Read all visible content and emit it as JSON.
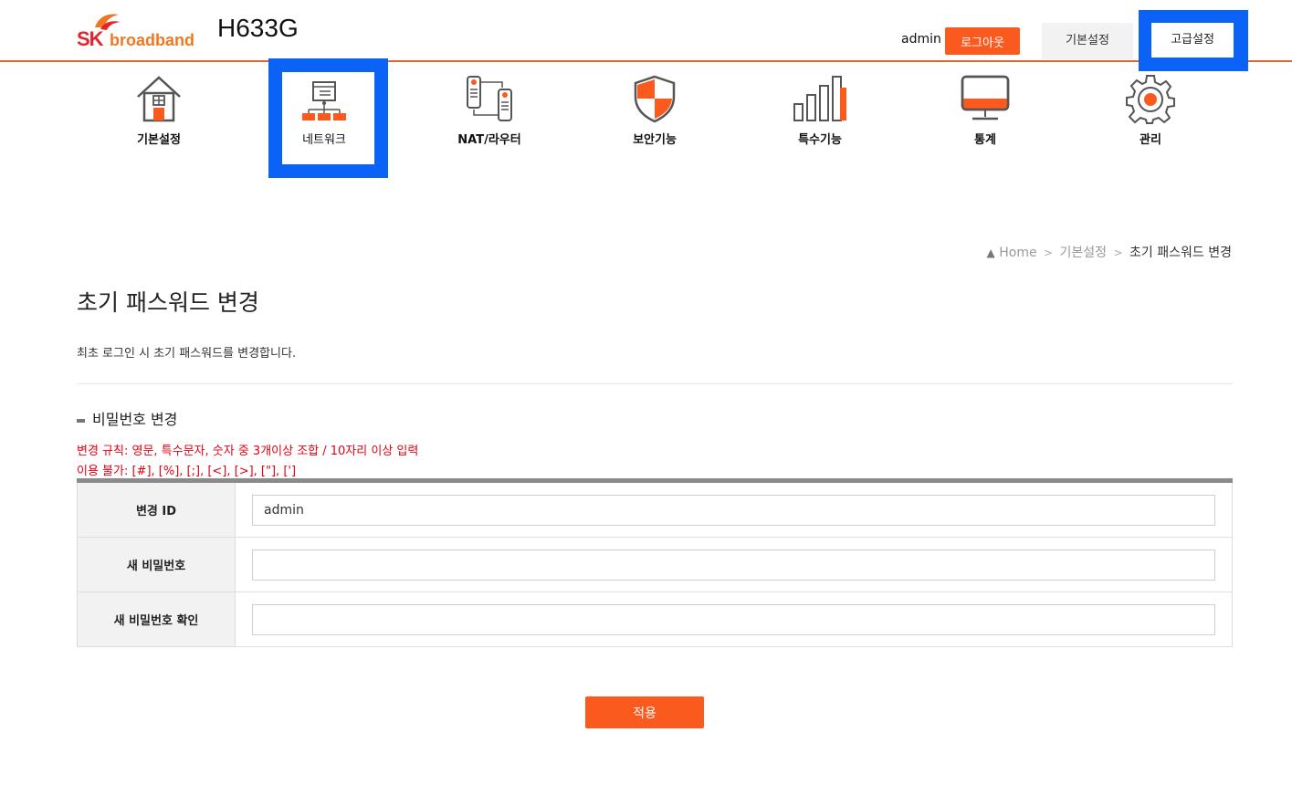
{
  "header": {
    "logo_sk": "SK",
    "logo_broadband": "broadband",
    "model": "H633G",
    "user": "admin",
    "logout_label": "로그아웃",
    "tab_basic": "기본설정",
    "tab_advanced": "고급설정"
  },
  "menu": {
    "items": [
      {
        "label": "기본설정",
        "icon": "home-icon"
      },
      {
        "label": "네트워크",
        "icon": "network-icon"
      },
      {
        "label": "NAT/라우터",
        "icon": "router-icon"
      },
      {
        "label": "보안기능",
        "icon": "shield-icon"
      },
      {
        "label": "특수기능",
        "icon": "bar-chart-icon"
      },
      {
        "label": "통계",
        "icon": "monitor-icon"
      },
      {
        "label": "관리",
        "icon": "gear-icon"
      }
    ]
  },
  "breadcrumb": {
    "home": "Home",
    "sep": ">",
    "level1": "기본설정",
    "current": "초기 패스워드 변경"
  },
  "page": {
    "title": "초기 패스워드 변경",
    "description": "최초 로그인 시 초기 패스워드를 변경합니다."
  },
  "section": {
    "title": "비밀번호 변경",
    "rule1": "변경 규칙: 영문, 특수문자, 숫자 중 3개이상 조합 / 10자리 이상 입력",
    "rule2": "이용 불가: [#], [%], [;], [<], [>], [\"], [']"
  },
  "form": {
    "id_label": "변경 ID",
    "id_value": "admin",
    "new_pw_label": "새 비밀번호",
    "new_pw_value": "",
    "confirm_pw_label": "새 비밀번호 확인",
    "confirm_pw_value": ""
  },
  "apply_label": "적용",
  "colors": {
    "accent": "#fb5a1f",
    "highlight": "#0a63f6",
    "warning_text": "#e60012"
  }
}
